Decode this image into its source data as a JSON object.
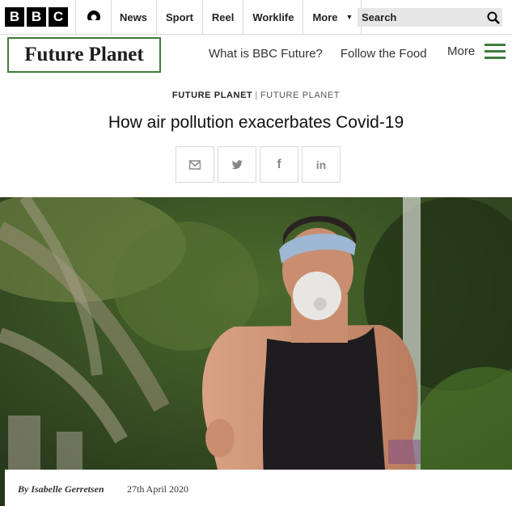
{
  "logo": {
    "letters": [
      "B",
      "B",
      "C"
    ]
  },
  "nav": {
    "items": [
      "News",
      "Sport",
      "Reel",
      "Worklife",
      "More"
    ]
  },
  "search": {
    "label": "Search"
  },
  "section": {
    "brand": "Future Planet",
    "links": [
      "What is BBC Future?",
      "Follow the Food"
    ],
    "more": "More"
  },
  "article": {
    "kicker_primary": "FUTURE PLANET",
    "kicker_separator": "|",
    "kicker_secondary": "FUTURE PLANET",
    "headline": "How air pollution exacerbates Covid-19",
    "share_icons": [
      "email-icon",
      "twitter-icon",
      "facebook-icon",
      "linkedin-icon"
    ],
    "share_glyphs": {
      "facebook": "f",
      "linkedin": "in"
    },
    "author": "By Isabelle Gerretsen",
    "date": "27th April 2020"
  },
  "colors": {
    "brand_green": "#3e7c3c",
    "logo_black": "#000000",
    "search_bg": "#e6e6e6"
  }
}
